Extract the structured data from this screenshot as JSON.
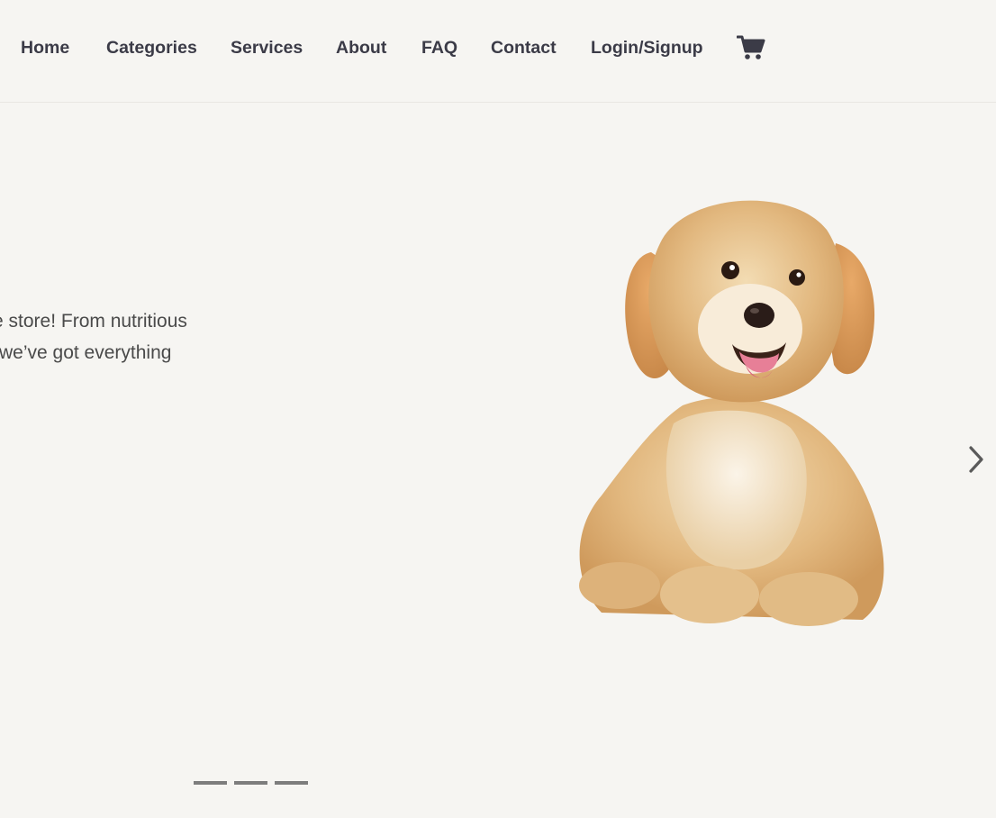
{
  "nav": {
    "links": [
      "Home",
      "Categories",
      "Services",
      "About",
      "FAQ",
      "Contact",
      "Login/Signup"
    ],
    "cart_icon": "shopping-cart-icon"
  },
  "hero": {
    "text_line1": "e store! From nutritious",
    "text_line2": "we’ve got everything",
    "image": "puppy-photo",
    "next_icon": "chevron-right-icon",
    "indicators": 3
  },
  "colors": {
    "background": "#f6f5f2",
    "nav_text": "#3b3b47",
    "body_text": "#4a4a4a",
    "indicator": "#7d7d7d"
  }
}
